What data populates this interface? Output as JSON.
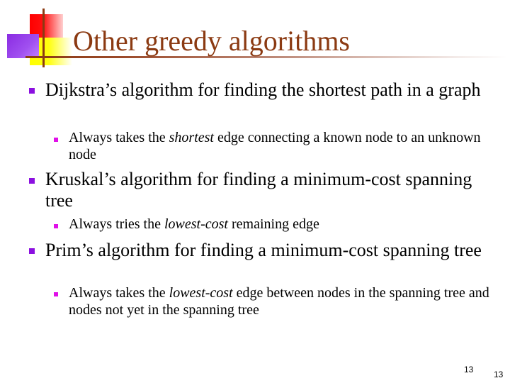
{
  "slide": {
    "title": "Other greedy algorithms",
    "colors": {
      "title": "#8b3a12",
      "bullet_level1": "#8b10e0",
      "bullet_level2": "#e010e8"
    },
    "bullets": [
      {
        "text": "Dijkstra’s algorithm for finding the shortest path in a graph",
        "sub": [
          {
            "before": "Always takes the ",
            "emph": "shortest",
            "after": " edge connecting a known node to an unknown node"
          }
        ]
      },
      {
        "text": "Kruskal’s algorithm for finding a minimum-cost spanning tree",
        "sub": [
          {
            "before": "Always tries the ",
            "emph": "lowest-cost",
            "after": " remaining edge"
          }
        ]
      },
      {
        "text": "Prim’s algorithm for finding a minimum-cost spanning tree",
        "sub": [
          {
            "before": "Always takes the ",
            "emph": "lowest-cost",
            "after": " edge between nodes in the spanning tree and nodes not yet in the spanning tree"
          }
        ]
      }
    ],
    "page_number_inner": "13",
    "page_number_outer": "13"
  }
}
